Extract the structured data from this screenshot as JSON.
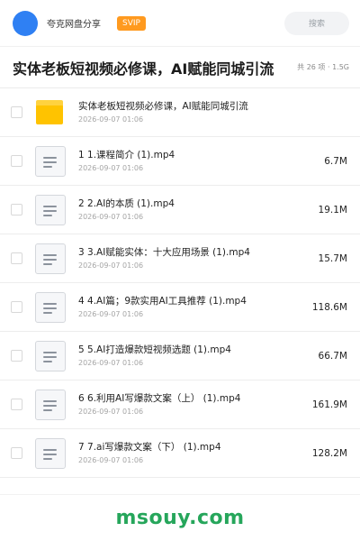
{
  "header": {
    "app_name": "夸克网盘分享",
    "vip_badge": "SVIP",
    "search_placeholder": "搜索"
  },
  "title_row": {
    "title": "实体老板短视频必修课，AI赋能同城引流",
    "summary": "共 26 项 · 1.5G"
  },
  "files": [
    {
      "type": "folder",
      "name": "实体老板短视频必修课，AI赋能同城引流",
      "date": "2026-09-07 01:06",
      "size": ""
    },
    {
      "type": "file",
      "name": "1 1.课程简介 (1).mp4",
      "date": "2026-09-07 01:06",
      "size": "6.7M"
    },
    {
      "type": "file",
      "name": "2 2.AI的本质 (1).mp4",
      "date": "2026-09-07 01:06",
      "size": "19.1M"
    },
    {
      "type": "file",
      "name": "3 3.AI赋能实体：十大应用场景 (1).mp4",
      "date": "2026-09-07 01:06",
      "size": "15.7M"
    },
    {
      "type": "file",
      "name": "4 4.AI篇；9款实用AI工具推荐 (1).mp4",
      "date": "2026-09-07 01:06",
      "size": "118.6M"
    },
    {
      "type": "file",
      "name": "5 5.AI打造爆款短视频选题 (1).mp4",
      "date": "2026-09-07 01:06",
      "size": "66.7M"
    },
    {
      "type": "file",
      "name": "6 6.利用AI写爆款文案（上） (1).mp4",
      "date": "2026-09-07 01:06",
      "size": "161.9M"
    },
    {
      "type": "file",
      "name": "7 7.ai写爆款文案（下） (1).mp4",
      "date": "2026-09-07 01:06",
      "size": "128.2M"
    }
  ],
  "watermark": "msouy.com",
  "colors": {
    "avatar": "#2f80f3",
    "vip_badge": "#ff9a1f",
    "folder": "#ffc300",
    "watermark": "#26a65b"
  }
}
